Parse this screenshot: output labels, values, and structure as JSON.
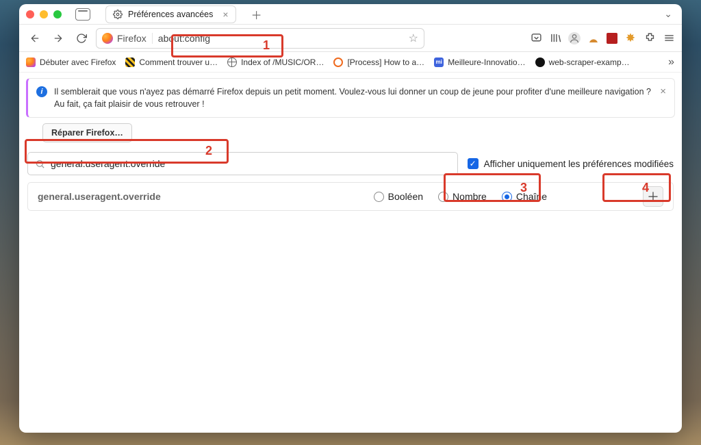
{
  "window": {
    "tab_title": "Préférences avancées"
  },
  "urlbar": {
    "browser_label": "Firefox",
    "location": "about:config"
  },
  "bookmarks": {
    "items": [
      {
        "label": "Débuter avec Firefox"
      },
      {
        "label": "Comment trouver u…"
      },
      {
        "label": "Index of /MUSIC/OR…"
      },
      {
        "label": "[Process] How to a…"
      },
      {
        "label": "Meilleure-Innovatio…"
      },
      {
        "label": "web-scraper-examp…"
      }
    ],
    "mi_label": "mi"
  },
  "infobar": {
    "message": "Il semblerait que vous n'ayez pas démarré Firefox depuis un petit moment. Voulez-vous lui donner un coup de jeune pour profiter d'une meilleure navigation ? Au fait, ça fait plaisir de vous retrouver !",
    "repair_label": "Réparer Firefox…"
  },
  "search": {
    "value": "general.useragent.override",
    "checkbox_label": "Afficher uniquement les préférences modifiées"
  },
  "pref": {
    "name": "general.useragent.override",
    "type_boolean": "Booléen",
    "type_number": "Nombre",
    "type_string": "Chaîne"
  },
  "annotations": {
    "n1": "1",
    "n2": "2",
    "n3": "3",
    "n4": "4"
  }
}
